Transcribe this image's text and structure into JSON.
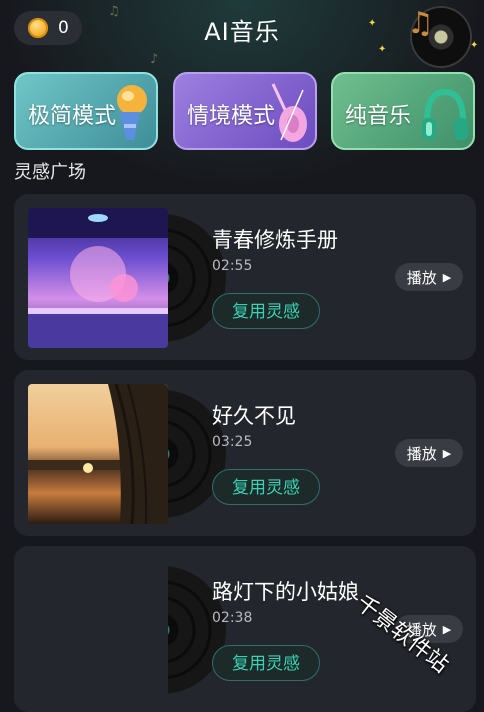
{
  "header": {
    "coin_count": "0",
    "title": "AI音乐"
  },
  "modes": [
    {
      "label": "极简模式",
      "icon": "microphone-icon"
    },
    {
      "label": "情境模式",
      "icon": "violin-icon"
    },
    {
      "label": "纯音乐",
      "icon": "headphones-icon"
    }
  ],
  "section_title": "灵感广场",
  "songs": [
    {
      "title": "青春修炼手册",
      "duration": "02:55",
      "reuse_label": "复用灵感",
      "play_label": "播放",
      "cover": "concert-stage"
    },
    {
      "title": "好久不见",
      "duration": "03:25",
      "reuse_label": "复用灵感",
      "play_label": "播放",
      "cover": "sunset-lake"
    },
    {
      "title": "路灯下的小姑娘",
      "duration": "02:38",
      "reuse_label": "复用灵感",
      "play_label": "播放",
      "cover": "blank"
    }
  ],
  "watermark": "千景软件站",
  "colors": {
    "background": "#17181d",
    "card": "#24262d",
    "accent": "#37d3b4"
  }
}
